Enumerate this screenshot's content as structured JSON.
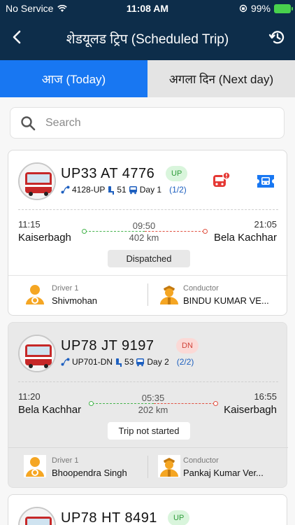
{
  "status_bar": {
    "carrier": "No Service",
    "time": "11:08 AM",
    "battery": "99%"
  },
  "header": {
    "title": "शेडयूलड ट्रिप (Scheduled Trip)"
  },
  "tabs": [
    {
      "label": "आज (Today)",
      "active": true
    },
    {
      "label": "अगला दिन (Next day)",
      "active": false
    }
  ],
  "search": {
    "placeholder": "Search",
    "value": ""
  },
  "trips": [
    {
      "vehicle": "UP33 AT 4776",
      "direction": "UP",
      "route_code": "4128-UP",
      "seats": "51",
      "day": "Day 1",
      "fraction": "(1/2)",
      "dep_time": "11:15",
      "arr_time": "21:05",
      "origin": "Kaiserbagh",
      "destination": "Bela Kachhar",
      "mid_time": "09:50",
      "distance": "402 km",
      "status": "Dispatched",
      "driver_label": "Driver 1",
      "driver": "Shivmohan",
      "conductor_label": "Conductor",
      "conductor": "BINDU KUMAR VE..."
    },
    {
      "vehicle": "UP78 JT 9197",
      "direction": "DN",
      "route_code": "UP701-DN",
      "seats": "53",
      "day": "Day 2",
      "fraction": "(2/2)",
      "dep_time": "11:20",
      "arr_time": "16:55",
      "origin": "Bela Kachhar",
      "destination": "Kaiserbagh",
      "mid_time": "05:35",
      "distance": "202 km",
      "status": "Trip not started",
      "driver_label": "Driver 1",
      "driver": "Bhoopendra Singh",
      "conductor_label": "Conductor",
      "conductor": "Pankaj Kumar Ver..."
    },
    {
      "vehicle": "UP78 HT 8491",
      "direction": "UP"
    }
  ],
  "colors": {
    "header_bg": "#0d2d4a",
    "tab_active": "#1877f2",
    "up_badge": "#2e9c3a",
    "dn_badge": "#d0443a",
    "icon_red": "#e53935",
    "icon_blue": "#1877f2"
  }
}
